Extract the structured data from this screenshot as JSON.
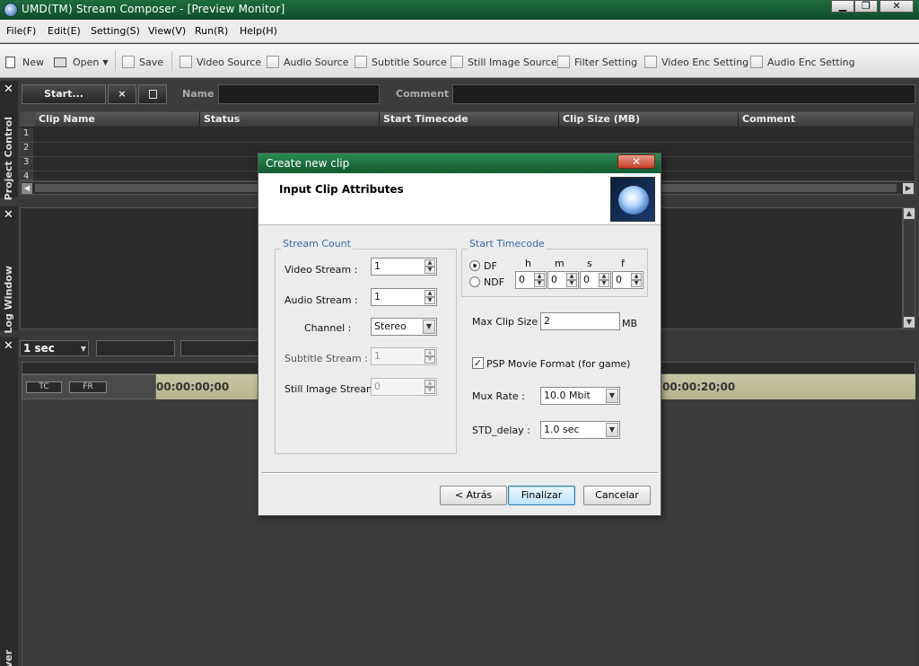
{
  "window": {
    "title": "UMD(TM) Stream Composer - [Preview Monitor]"
  },
  "menu": [
    "File(F)",
    "Edit(E)",
    "Setting(S)",
    "View(V)",
    "Run(R)",
    "Help(H)"
  ],
  "toolbar": {
    "new": "New",
    "open": "Open",
    "save": "Save",
    "items": [
      "Video Source",
      "Audio Source",
      "Subtitle Source",
      "Still Image Source",
      "Filter Setting",
      "Video Enc Setting",
      "Audio Enc Setting"
    ]
  },
  "project": {
    "tab_label": "Project Control",
    "start_button": "Start...",
    "delete_button": "×",
    "name_label": "Name",
    "comment_label": "Comment",
    "columns": [
      "Clip Name",
      "Status",
      "Start Timecode",
      "Clip Size (MB)",
      "Comment"
    ],
    "rows": [
      "1",
      "2",
      "3",
      "4"
    ]
  },
  "log": {
    "tab_label": "Log Window"
  },
  "timeline": {
    "zoom": "1 sec",
    "tc_button": "TC",
    "fr_button": "FR",
    "start_tc": "00:00:00;00",
    "end_tc": "00:00:20;00",
    "bottom_tab": "ver"
  },
  "dialog": {
    "title": "Create new clip",
    "heading": "Input Clip Attributes",
    "stream_count": {
      "title": "Stream Count",
      "video_label": "Video Stream :",
      "video_value": "1",
      "audio_label": "Audio Stream :",
      "audio_value": "1",
      "channel_label": "Channel :",
      "channel_value": "Stereo",
      "subtitle_label": "Subtitle Stream :",
      "subtitle_value": "1",
      "still_label": "Still Image Stream :",
      "still_value": "0"
    },
    "start_timecode": {
      "title": "Start Timecode",
      "df": "DF",
      "ndf": "NDF",
      "h_label": "h",
      "m_label": "m",
      "s_label": "s",
      "f_label": "f",
      "h": "0",
      "m": "0",
      "s": "0",
      "f": "0",
      "selected": "DF"
    },
    "max_clip_label": "Max Clip Size :",
    "max_clip_value": "2",
    "max_clip_unit": "MB",
    "psp_label": "PSP Movie Format (for game)",
    "psp_checked": true,
    "mux_label": "Mux Rate :",
    "mux_value": "10.0 Mbit",
    "std_label": "STD_delay :",
    "std_value": "1.0 sec",
    "back_button": "< Atrás",
    "finish_button": "Finalizar",
    "cancel_button": "Cancelar"
  }
}
